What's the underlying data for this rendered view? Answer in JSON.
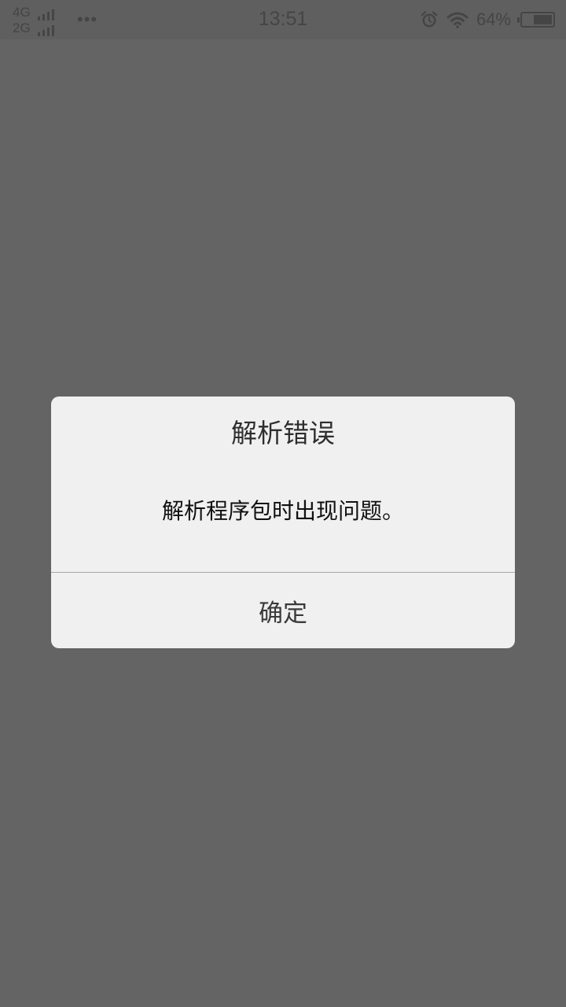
{
  "status_bar": {
    "network_1": "4G",
    "network_2": "2G",
    "more_dots": "•••",
    "time": "13:51",
    "battery_percent": "64%",
    "battery_level": 0.64,
    "icons": [
      "signal-icon",
      "alarm-icon",
      "wifi-icon",
      "battery-icon"
    ]
  },
  "dialog": {
    "title": "解析错误",
    "message": "解析程序包时出现问题。",
    "confirm_label": "确定"
  },
  "colors": {
    "overlay": "#646464",
    "dialog_bg": "#f0f0f0",
    "divider": "#a8a8a8"
  }
}
